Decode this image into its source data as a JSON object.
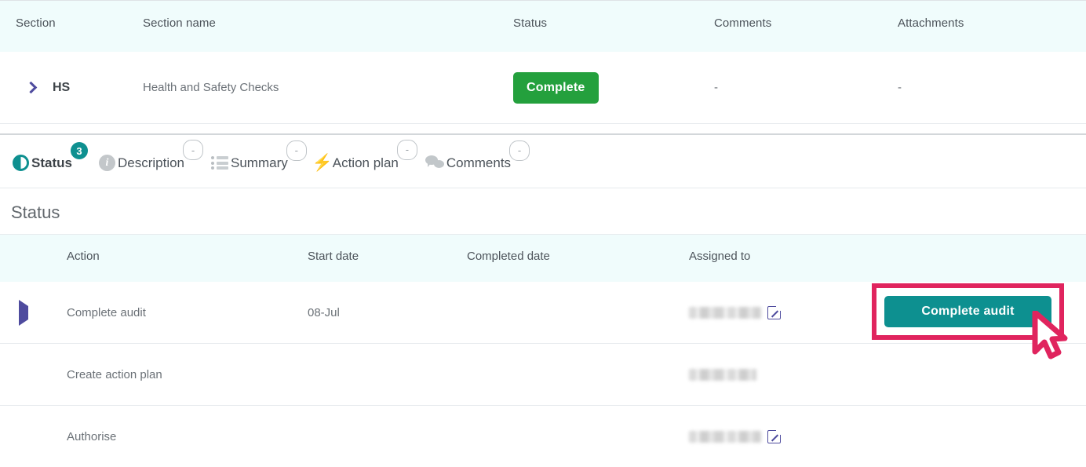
{
  "sections_table": {
    "columns": [
      "Section",
      "Section name",
      "Status",
      "Comments",
      "Attachments"
    ],
    "rows": [
      {
        "expander_icon": "chevron-right-icon",
        "section": "HS",
        "section_name": "Health and Safety Checks",
        "status": "Complete",
        "status_color": "#24a03d",
        "comments": "-",
        "attachments": "-"
      }
    ]
  },
  "tabs": [
    {
      "label": "Status",
      "icon": "contrast-circle-icon",
      "badge": "3",
      "badge_empty": false,
      "active": true
    },
    {
      "label": "Description",
      "icon": "info-circle-icon",
      "badge": "-",
      "badge_empty": true,
      "active": false
    },
    {
      "label": "Summary",
      "icon": "list-icon",
      "badge": "-",
      "badge_empty": true,
      "active": false
    },
    {
      "label": "Action plan",
      "icon": "lightning-bolt-icon",
      "badge": "-",
      "badge_empty": true,
      "active": false
    },
    {
      "label": "Comments",
      "icon": "speech-bubbles-icon",
      "badge": "-",
      "badge_empty": true,
      "active": false
    }
  ],
  "status_panel": {
    "title": "Status",
    "columns": [
      "Action",
      "Start date",
      "Completed date",
      "Assigned to"
    ],
    "rows": [
      {
        "marker_icon": "play-triangle-icon",
        "has_marker": true,
        "action": "Complete audit",
        "start_date": "08-Jul",
        "completed_date": "",
        "assigned_to": "",
        "assigned_redacted": true,
        "assigned_redacted_width": 92,
        "has_edit_icon": true,
        "action_button": "Complete audit",
        "highlighted": true
      },
      {
        "marker_icon": "",
        "has_marker": false,
        "action": "Create action plan",
        "start_date": "",
        "completed_date": "",
        "assigned_to": "",
        "assigned_redacted": true,
        "assigned_redacted_width": 86,
        "has_edit_icon": false,
        "action_button": "",
        "highlighted": false
      },
      {
        "marker_icon": "",
        "has_marker": false,
        "action": "Authorise",
        "start_date": "",
        "completed_date": "",
        "assigned_to": "",
        "assigned_redacted": true,
        "assigned_redacted_width": 92,
        "has_edit_icon": true,
        "action_button": "",
        "highlighted": false
      }
    ]
  },
  "theme": {
    "accent_teal": "#0d9090",
    "highlight_pink": "#e0245e",
    "success_green": "#24a03d",
    "purple": "#4e4b9e",
    "table_header_bg": "#f0fcfc"
  },
  "cursor": {
    "icon": "mouse-pointer-icon",
    "color": "#e0245e"
  }
}
